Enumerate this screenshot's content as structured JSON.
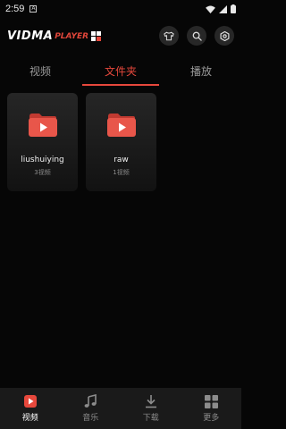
{
  "status": {
    "time": "2:59",
    "notif_glyph": "A"
  },
  "app": {
    "logo_main": "VIDMA",
    "logo_sub": "PLAYER",
    "accent": "#e7483c"
  },
  "toolbar": {
    "icons": [
      "tshirt-icon",
      "search-icon",
      "settings-icon"
    ]
  },
  "tabs": [
    {
      "label": "视频",
      "active": false
    },
    {
      "label": "文件夹",
      "active": true
    },
    {
      "label": "播放",
      "active": false
    }
  ],
  "folders": [
    {
      "name": "liushuiying",
      "count": "3视频"
    },
    {
      "name": "raw",
      "count": "1视频"
    }
  ],
  "bottom_nav": [
    {
      "label": "视频",
      "icon": "play-icon",
      "active": true
    },
    {
      "label": "音乐",
      "icon": "music-note-icon",
      "active": false
    },
    {
      "label": "下载",
      "icon": "download-icon",
      "active": false
    },
    {
      "label": "更多",
      "icon": "grid-icon",
      "active": false
    }
  ]
}
